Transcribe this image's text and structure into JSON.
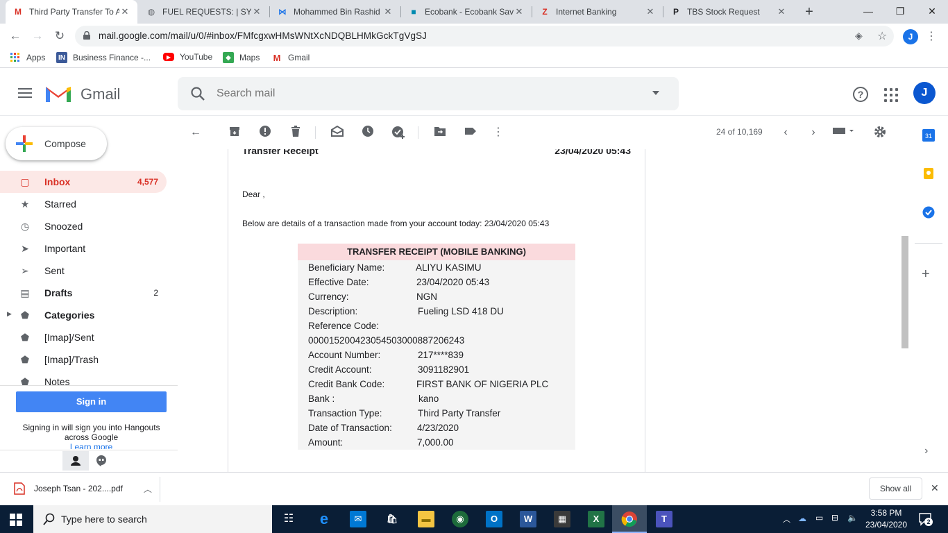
{
  "browser": {
    "tabs": [
      {
        "label": "Third Party Transfer To A",
        "fav": "M",
        "fav_color": "#d93025",
        "active": true
      },
      {
        "label": "FUEL REQUESTS: | SYST",
        "fav": "◍",
        "fav_color": "#5f6368",
        "active": false
      },
      {
        "label": "Mohammed Bin Rashid",
        "fav": "⋈",
        "fav_color": "#1a73e8",
        "active": false
      },
      {
        "label": "Ecobank - Ecobank Sav",
        "fav": "■",
        "fav_color": "#008ab0",
        "active": false
      },
      {
        "label": "Internet Banking",
        "fav": "Z",
        "fav_color": "#d93025",
        "active": false
      },
      {
        "label": "TBS Stock Request",
        "fav": "P",
        "fav_color": "#202124",
        "active": false
      }
    ],
    "url": "mail.google.com/mail/u/0/#inbox/FMfcgxwHMsWNtXcNDQBLHMkGckTgVgSJ",
    "profile_letter": "J",
    "bookmarks": [
      {
        "label": "Apps",
        "icon": "grid"
      },
      {
        "label": "Business Finance -...",
        "icon": "IN",
        "color": "#3c5a99"
      },
      {
        "label": "YouTube",
        "icon": "▶",
        "color": "#ff0000"
      },
      {
        "label": "Maps",
        "icon": "◆",
        "color": "#34a853"
      },
      {
        "label": "Gmail",
        "icon": "M",
        "color": "#d93025"
      }
    ]
  },
  "gmail": {
    "product": "Gmail",
    "search_placeholder": "Search mail",
    "avatar_letter": "J",
    "compose_label": "Compose",
    "nav": [
      {
        "label": "Inbox",
        "count": "4,577",
        "icon": "▢",
        "active": true
      },
      {
        "label": "Starred",
        "count": "",
        "icon": "★"
      },
      {
        "label": "Snoozed",
        "count": "",
        "icon": "◷"
      },
      {
        "label": "Important",
        "count": "",
        "icon": "➤"
      },
      {
        "label": "Sent",
        "count": "",
        "icon": "➢"
      },
      {
        "label": "Drafts",
        "count": "2",
        "icon": "▤",
        "bold": true
      },
      {
        "label": "Categories",
        "count": "",
        "icon": "⬟",
        "bold": true
      },
      {
        "label": "[Imap]/Sent",
        "count": "",
        "icon": "⬟"
      },
      {
        "label": "[Imap]/Trash",
        "count": "",
        "icon": "⬟"
      },
      {
        "label": "Notes",
        "count": "",
        "icon": "⬟"
      }
    ],
    "hangouts": {
      "signin_label": "Sign in",
      "signin_text": "Signing in will sign you into Hangouts across Google",
      "learn_more": "Learn more"
    },
    "pager": "24 of 10,169"
  },
  "message": {
    "receipt_title": "Transfer Receipt",
    "receipt_date": "23/04/2020 05:43",
    "greeting": "Dear ,",
    "intro": "Below are details of a transaction made from your account today: 23/04/2020 05:43",
    "table_title": "TRANSFER RECEIPT (MOBILE BANKING)",
    "rows": [
      {
        "label": "Beneficiary Name:",
        "value": "ALIYU KASIMU"
      },
      {
        "label": "Effective Date:",
        "value": "23/04/2020 05:43"
      },
      {
        "label": "Currency:",
        "value": "NGN"
      },
      {
        "label": "Description:",
        "value": "Fueling LSD 418 DU"
      },
      {
        "label": "Reference Code:",
        "value": ""
      },
      {
        "label": "000015200423054503000887206243",
        "value": ""
      },
      {
        "label": "Account Number:",
        "value": "217****839"
      },
      {
        "label": "Credit Account:",
        "value": "3091182901"
      },
      {
        "label": "Credit Bank Code:",
        "value": "FIRST BANK OF NIGERIA PLC"
      },
      {
        "label": "Bank :",
        "value": "kano"
      },
      {
        "label": "Transaction Type:",
        "value": "Third Party Transfer"
      },
      {
        "label": "Date of Transaction:",
        "value": "4/23/2020"
      },
      {
        "label": "Amount:",
        "value": "7,000.00"
      }
    ]
  },
  "downloads": {
    "file": "Joseph Tsan - 202....pdf",
    "show_all": "Show all"
  },
  "taskbar": {
    "search_label": "Type here to search",
    "time": "3:58 PM",
    "date": "23/04/2020",
    "notif_count": "2"
  }
}
